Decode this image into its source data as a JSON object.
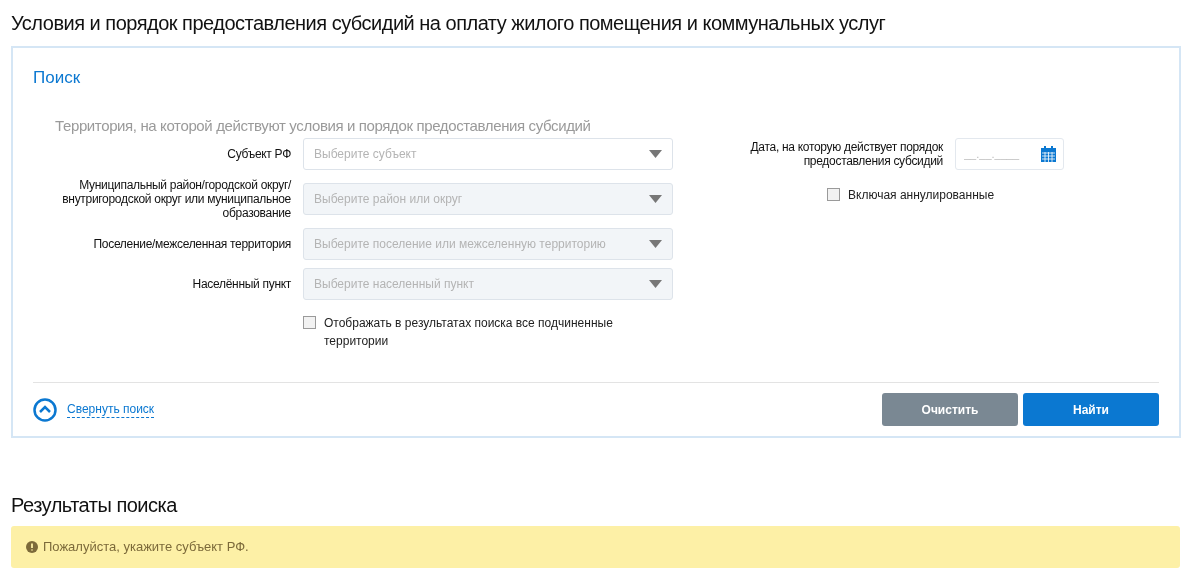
{
  "page_title": "Условия и порядок предоставления субсидий на оплату жилого помещения и коммунальных услуг",
  "search": {
    "title": "Поиск",
    "section_title": "Территория, на которой действуют условия и порядок предоставления субсидий",
    "fields": [
      {
        "label": "Субъект РФ",
        "placeholder": "Выберите субъект",
        "disabled": false
      },
      {
        "label": "Муниципальный район/городской округ/внутригородской округ или муниципальное образование",
        "placeholder": "Выберите район или округ",
        "disabled": true
      },
      {
        "label": "Поселение/межселенная территория",
        "placeholder": "Выберите поселение или межселенную территорию",
        "disabled": true
      },
      {
        "label": "Населённый пункт",
        "placeholder": "Выберите населенный пункт",
        "disabled": true
      }
    ],
    "subordinate_checkbox": {
      "label": "Отображать в результатах поиска все подчиненные территории",
      "checked": false
    },
    "date": {
      "label": "Дата, на которую действует порядок предоставления субсидий",
      "placeholder": "__.__.____"
    },
    "cancelled_checkbox": {
      "label": "Включая аннулированные",
      "checked": false
    },
    "collapse_link": "Свернуть поиск",
    "buttons": [
      {
        "label": "Очистить",
        "kind": "secondary"
      },
      {
        "label": "Найти",
        "kind": "primary"
      }
    ]
  },
  "results": {
    "title": "Результаты поиска",
    "alert": "Пожалуйста, укажите субъект РФ."
  }
}
